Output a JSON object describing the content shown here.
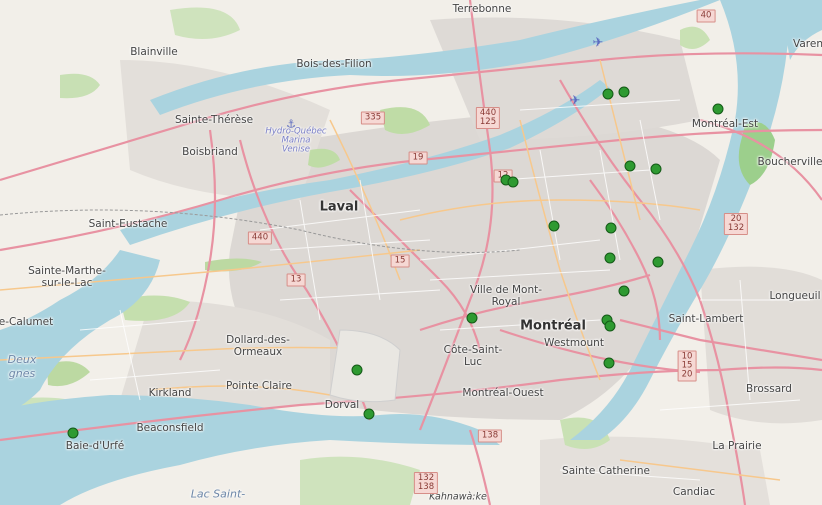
{
  "map": {
    "places": {
      "terrebonne": "Terrebonne",
      "blainville": "Blainville",
      "bois_des_filion": "Bois-des-Filion",
      "sainte_therese": "Sainte-Thérèse",
      "boisbriand": "Boisbriand",
      "laval": "Laval",
      "saint_eustache": "Saint-Eustache",
      "sainte_marthe": "Sainte-Marthe-\nsur-le-Lac",
      "calumet": "e-Calumet",
      "dollard": "Dollard-des-\nOrmeaux",
      "pointe_claire": "Pointe Claire",
      "kirkland": "Kirkland",
      "beaconsfield": "Beaconsfield",
      "baie_durfe": "Baie-d'Urfé",
      "dorval": "Dorval",
      "montreal": "Montréal",
      "ville_mont_royal": "Ville de Mont-\nRoyal",
      "westmount": "Westmount",
      "cote_saint_luc": "Côte-Saint-\nLuc",
      "montreal_ouest": "Montréal-Ouest",
      "montreal_est": "Montréal-Est",
      "boucherville": "Boucherville",
      "longueuil": "Longueuil",
      "saint_lambert": "Saint-Lambert",
      "brossard": "Brossard",
      "la_prairie": "La Prairie",
      "candiac": "Candiac",
      "sainte_catherine": "Sainte Catherine",
      "kahnawake": "Kahnawà:ke",
      "varennes": "Varen",
      "deux_montagnes": "Deux\ngnes",
      "lac_saint": "Lac Saint-",
      "hydro": "Hydro-Québec\nMarina\nVenise"
    },
    "shields": [
      {
        "id": "335",
        "text": "335"
      },
      {
        "id": "440_125",
        "text": "440\n125"
      },
      {
        "id": "19",
        "text": "19"
      },
      {
        "id": "15a",
        "text": "15"
      },
      {
        "id": "440",
        "text": "440"
      },
      {
        "id": "13",
        "text": "13"
      },
      {
        "id": "40",
        "text": "40"
      },
      {
        "id": "20_132",
        "text": "20\n132"
      },
      {
        "id": "10_15_20",
        "text": "10\n15\n20"
      },
      {
        "id": "138",
        "text": "138"
      },
      {
        "id": "132_138",
        "text": "132\n138"
      },
      {
        "id": "12x",
        "text": "12"
      }
    ],
    "marker_count": 20
  }
}
